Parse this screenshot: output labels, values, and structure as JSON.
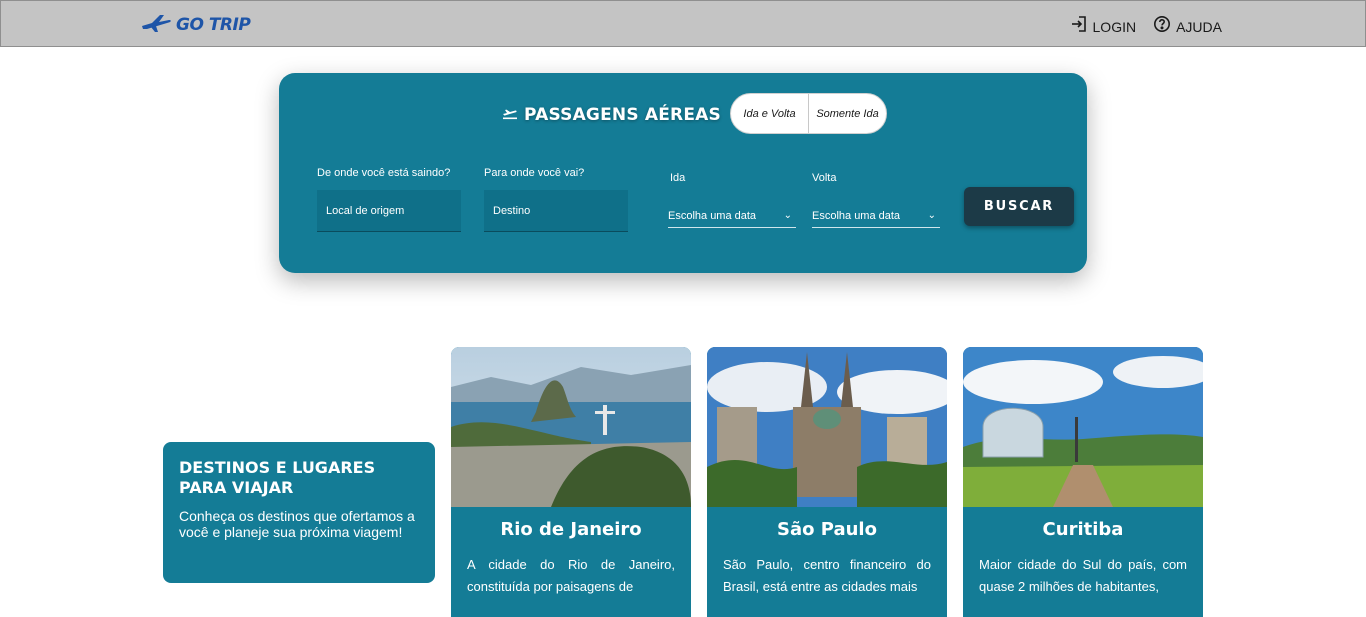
{
  "header": {
    "logo_text": "GO TRIP",
    "logo_icon": "airplane-icon",
    "nav": [
      {
        "label": "LOGIN",
        "icon": "login-icon"
      },
      {
        "label": "AJUDA",
        "icon": "help-icon"
      }
    ]
  },
  "search": {
    "title": "PASSAGENS AÉREAS",
    "trip_types": [
      "Ida e Volta",
      "Somente Ida"
    ],
    "origin_label": "De onde você está saindo?",
    "origin_placeholder": "Local de origem",
    "destination_label": "Para onde você vai?",
    "destination_placeholder": "Destino",
    "departure_label": "Ida",
    "departure_value": "Escolha uma data",
    "return_label": "Volta",
    "return_value": "Escolha uma data",
    "button_label": "BUSCAR"
  },
  "destinations": {
    "title": "DESTINOS E LUGARES PARA VIAJAR",
    "subtitle": "Conheça os destinos que ofertamos a você e planeje sua próxima viagem!",
    "cards": [
      {
        "name": "Rio de Janeiro",
        "description": "A cidade do Rio de Janeiro, constituída por paisagens de"
      },
      {
        "name": "São Paulo",
        "description": "São Paulo, centro financeiro do Brasil, está entre as cidades mais"
      },
      {
        "name": "Curitiba",
        "description": "Maior cidade do Sul do país, com quase 2 milhões de habitantes,"
      }
    ]
  },
  "colors": {
    "header_bg": "#c4c4c4",
    "brand_blue": "#1e55a8",
    "panel_teal": "#147c96",
    "button_dark": "#1c3a47"
  }
}
